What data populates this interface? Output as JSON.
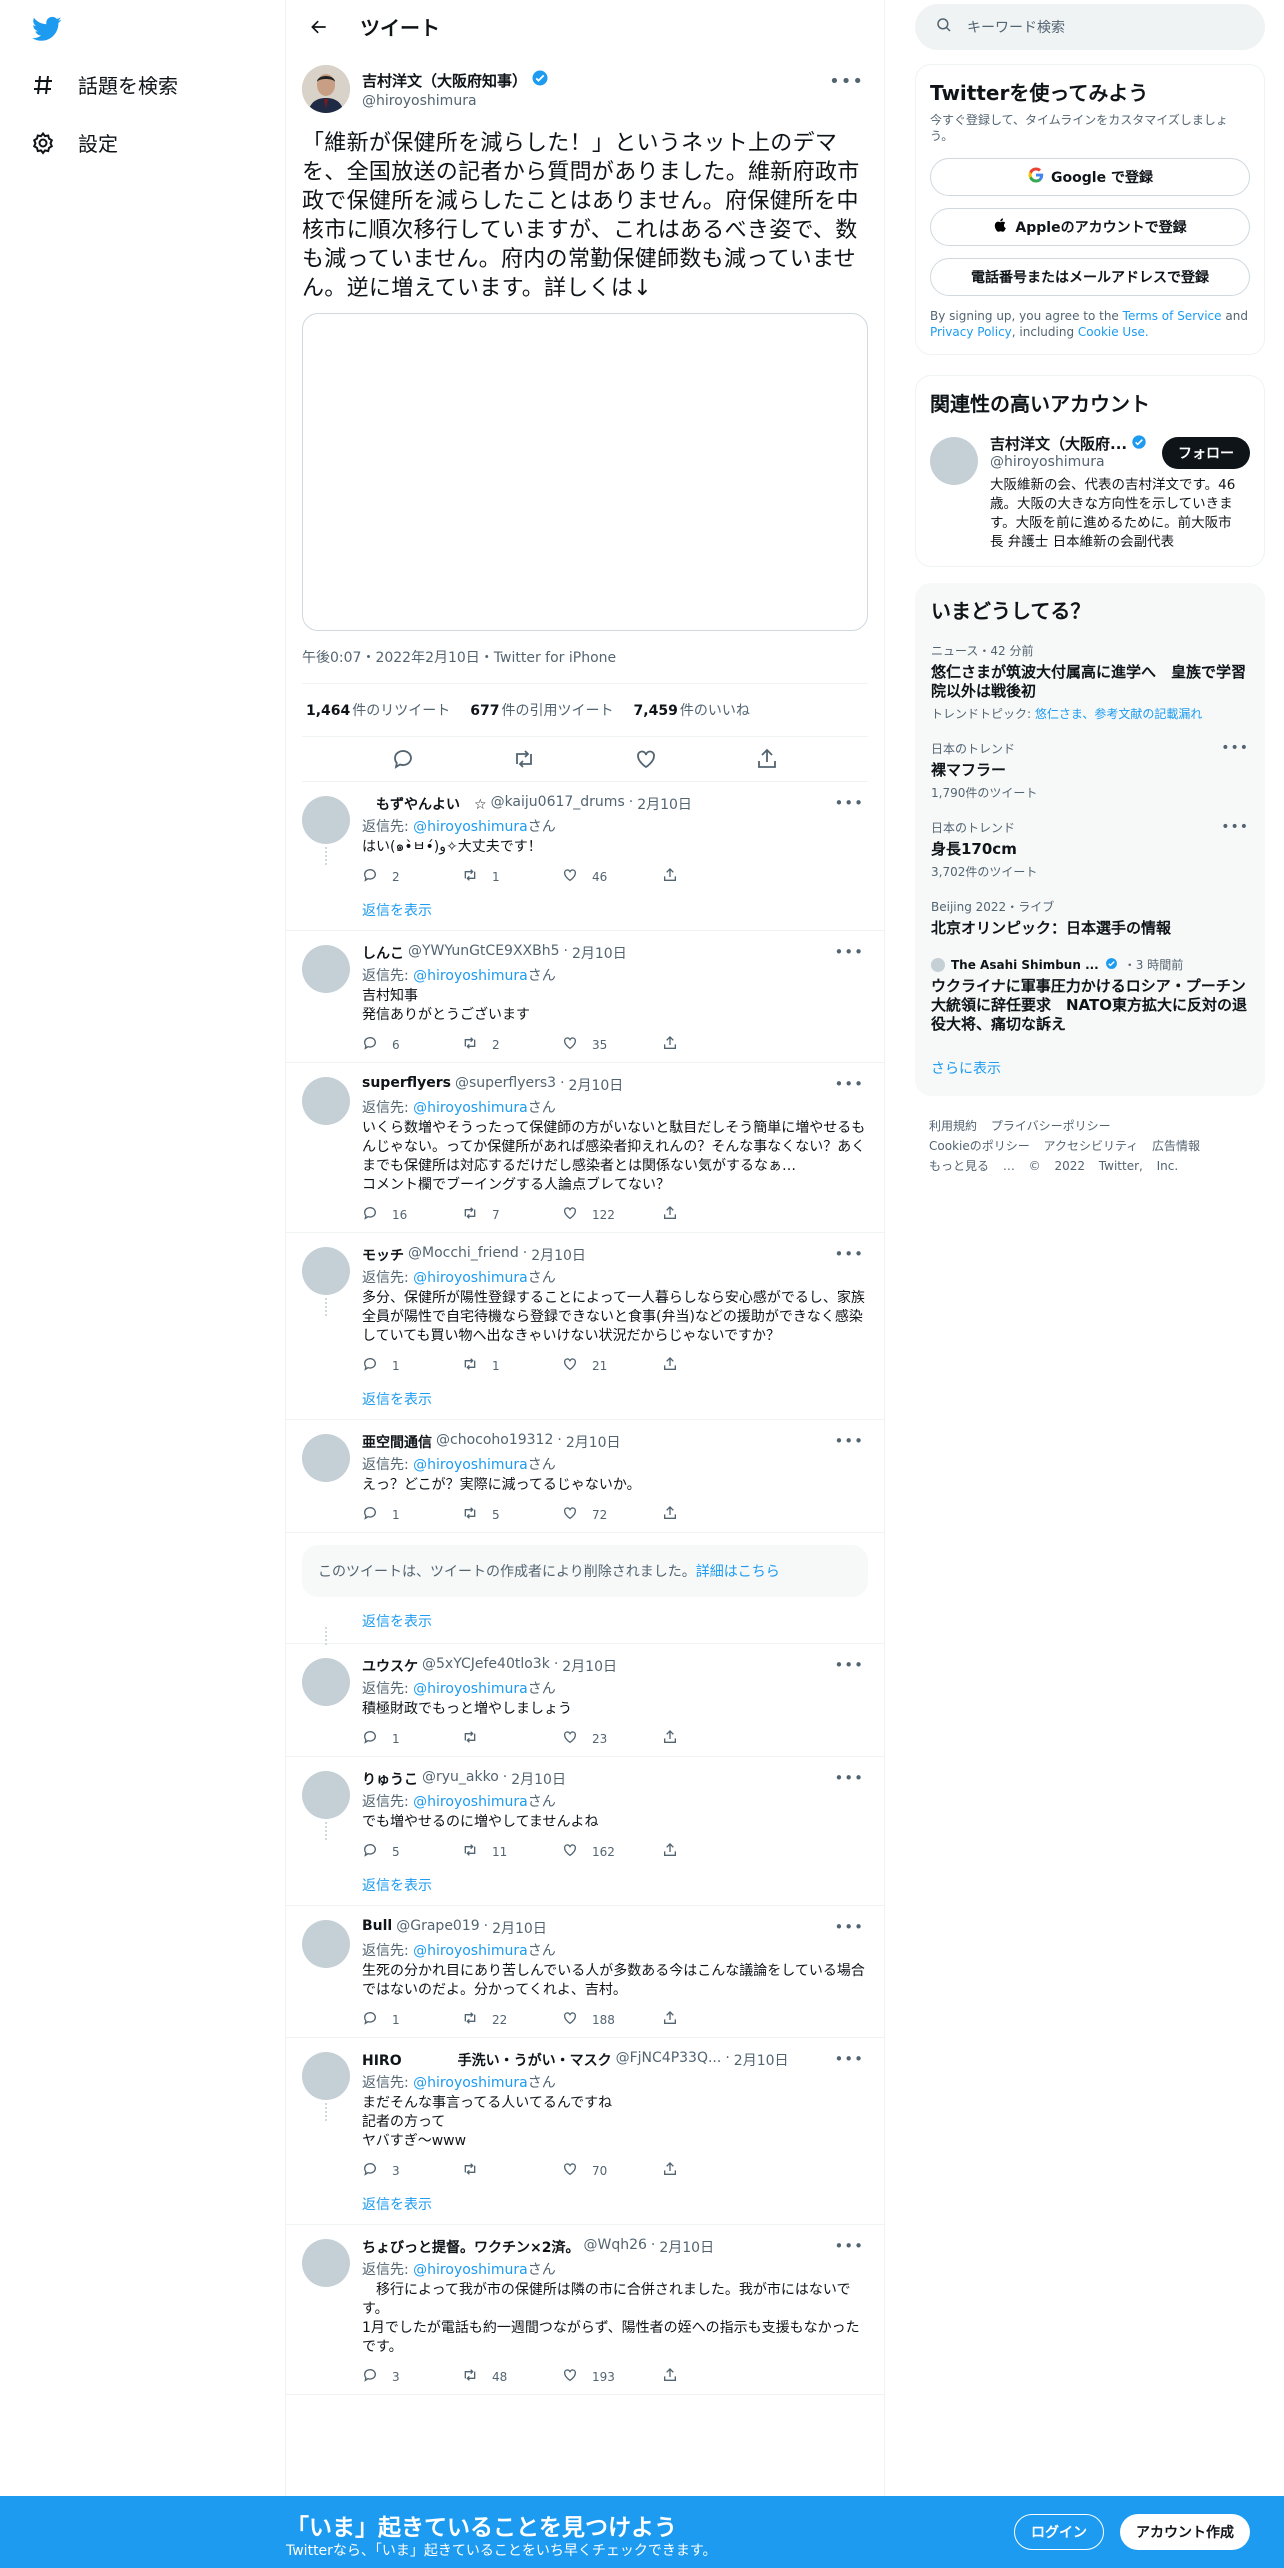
{
  "colors": {
    "accent": "#1d9bf0",
    "text": "#0f1419",
    "muted": "#536471"
  },
  "nav": {
    "explore": "話題を検索",
    "settings": "設定"
  },
  "header": {
    "title": "ツイート"
  },
  "main_tweet": {
    "name": "吉村洋文（大阪府知事）",
    "handle": "@hiroyoshimura",
    "text": "「維新が保健所を減らした！」というネット上のデマを、全国放送の記者から質問がありました。維新府政市政で保健所を減らしたことはありません。府保健所を中核市に順次移行していますが、これはあるべき姿で、数も減っていません。府内の常勤保健師数も減っていません。逆に増えています。詳しくは↓",
    "meta": "午後0:07・2022年2月10日・Twitter for iPhone",
    "retweets": "1,464",
    "retweets_label": "件のリツイート",
    "quotes": "677",
    "quotes_label": "件の引用ツイート",
    "likes": "7,459",
    "likes_label": "件のいいね"
  },
  "replying_prefix": "返信先:",
  "replying_mention": "@hiroyoshimura",
  "replying_suffix": "さん",
  "show_replies": "返信を表示",
  "replies": [
    {
      "name": "　もずやんよい　☆",
      "handle": "@kaiju0617_drums",
      "date": "2月10日",
      "text": "はい(๑•̀ㅂ•́)و✧大丈夫です！",
      "reply": "2",
      "rt": "1",
      "like": "46",
      "show_more": true
    },
    {
      "name": "しんこ",
      "handle": "@YWYunGtCE9XXBh5",
      "date": "2月10日",
      "text": "吉村知事\n発信ありがとうございます",
      "reply": "6",
      "rt": "2",
      "like": "35",
      "show_more": false
    },
    {
      "name": "superflyers",
      "handle": "@superflyers3",
      "date": "2月10日",
      "text": "いくら数増やそうったって保健師の方がいないと駄目だしそう簡単に増やせるもんじゃない。ってか保健所があれば感染者抑えれんの？そんな事なくない？あくまでも保健所は対応するだけだし感染者とは関係ない気がするなぁ…\nコメント欄でブーイングする人論点ブレてない？",
      "reply": "16",
      "rt": "7",
      "like": "122",
      "show_more": false
    },
    {
      "name": "モッチ",
      "handle": "@Mocchi_friend",
      "date": "2月10日",
      "text": "多分、保健所が陽性登録することによって一人暮らしなら安心感がでるし、家族全員が陽性で自宅待機なら登録できないと食事(弁当)などの援助ができなく感染していても買い物へ出なきゃいけない状況だからじゃないですか？",
      "reply": "1",
      "rt": "1",
      "like": "21",
      "show_more": true
    },
    {
      "name": "亜空間通信",
      "handle": "@chocoho19312",
      "date": "2月10日",
      "text": "えっ？どこが？実際に減ってるじゃないか。",
      "reply": "1",
      "rt": "5",
      "like": "72",
      "show_more": false
    }
  ],
  "deleted_notice": "このツイートは、ツイートの作成者により削除されました。",
  "deleted_link": "詳細はこちら",
  "replies2": [
    {
      "name": "ユウスケ",
      "handle": "@5xYCJefe40tlo3k",
      "date": "2月10日",
      "text": "積極財政でもっと増やしましょう",
      "reply": "1",
      "rt": "",
      "like": "23",
      "show_more": false
    },
    {
      "name": "りゅうこ",
      "handle": "@ryu_akko",
      "date": "2月10日",
      "text": "でも増やせるのに増やしてませんよね",
      "reply": "5",
      "rt": "11",
      "like": "162",
      "show_more": true
    },
    {
      "name": "Bull",
      "handle": "@Grape019",
      "date": "2月10日",
      "text": "生死の分かれ目にあり苦しんでいる人が多数ある今はこんな議論をしている場合ではないのだよ。分かってくれよ、吉村。",
      "reply": "1",
      "rt": "22",
      "like": "188",
      "show_more": false
    },
    {
      "name": "HIRO　　　　手洗い・うがい・マスク",
      "handle": "@FjNC4P33Q...",
      "date": "2月10日",
      "text": "まだそんな事言ってる人いてるんですね\n記者の方って\nヤバすぎ〜www",
      "reply": "3",
      "rt": "",
      "like": "70",
      "show_more": true
    },
    {
      "name": "ちょびっと提督。ワクチン×2済。",
      "handle": "@Wqh26",
      "date": "2月10日",
      "text": "　移行によって我が市の保健所は隣の市に合併されました。我が市にはないです。\n1月でしたが電話も約一週間つながらず、陽性者の姪への指示も支援もなかったです。",
      "reply": "3",
      "rt": "48",
      "like": "193",
      "show_more": false
    }
  ],
  "right": {
    "search_placeholder": "キーワード検索",
    "signup_title": "Twitterを使ってみよう",
    "signup_sub": "今すぐ登録して、タイムラインをカスタマイズしましょう。",
    "google_btn": "Google で登録",
    "apple_btn": "Appleのアカウントで登録",
    "phone_btn": "電話番号またはメールアドレスで登録",
    "legal_1": "By signing up, you agree to the",
    "legal_terms": "Terms of Service",
    "legal_and": "and",
    "legal_privacy": "Privacy Policy",
    "legal_including": ", including",
    "legal_cookie": "Cookie Use.",
    "related_title": "関連性の高いアカウント",
    "related_name": "吉村洋文（大阪府...",
    "related_handle": "@hiroyoshimura",
    "follow": "フォロー",
    "related_bio": "大阪維新の会、代表の吉村洋文です。46歳。大阪の大きな方向性を示していきます。大阪を前に進めるために。前大阪市長 弁護士 日本維新の会副代表",
    "trends_title": "いまどうしてる？",
    "trends": [
      {
        "cat": "ニュース・42 分前",
        "title": "悠仁さまが筑波大付属高に進学へ　皇族で学習院以外は戦後初",
        "sub_prefix": "トレンドトピック: ",
        "sub_link": "悠仁さま、参考文献の記載漏れ",
        "count": ""
      },
      {
        "cat": "日本のトレンド",
        "title": "裸マフラー",
        "sub_prefix": "",
        "sub_link": "",
        "count": "1,790件のツイート"
      },
      {
        "cat": "日本のトレンド",
        "title": "身長170cm",
        "sub_prefix": "",
        "sub_link": "",
        "count": "3,702件のツイート"
      },
      {
        "cat": "Beijing 2022・ライブ",
        "title": "北京オリンピック：日本選手の情報",
        "sub_prefix": "",
        "sub_link": "",
        "count": ""
      }
    ],
    "news_source": "The Asahi Shimbun ...",
    "news_time": "・3 時間前",
    "news_title": "ウクライナに軍事圧力かけるロシア・プーチン大統領に辞任要求　NATO東方拡大に反対の退役大将、痛切な訴え",
    "more": "さらに表示",
    "footer_line1": "利用規約 プライバシーポリシー",
    "footer_line2": "Cookieのポリシー アクセシビリティ 広告情報",
    "footer_line3": "もっと見る … © 2022 Twitter, Inc."
  },
  "bottom": {
    "title": "「いま」起きていることを見つけよう",
    "sub": "Twitterなら、「いま」起きていることをいち早くチェックできます。",
    "login": "ログイン",
    "signup": "アカウント作成"
  }
}
